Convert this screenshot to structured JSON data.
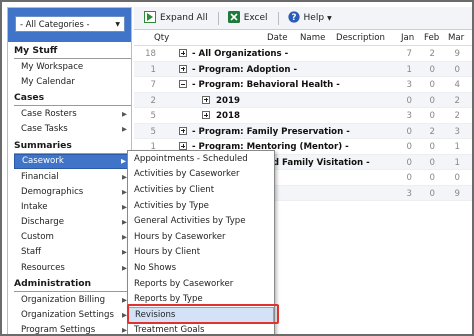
{
  "colors": {
    "accent": "#3f74c9",
    "highlight_border": "#e0322e",
    "menu_highlight": "#d3e2f7"
  },
  "sidebar": {
    "category_select": {
      "value": "- All Categories -",
      "icon": "chevron-down-icon"
    },
    "sections": [
      {
        "title": "My Stuff",
        "items": [
          {
            "label": "My Workspace",
            "submenu": false
          },
          {
            "label": "My Calendar",
            "submenu": false
          }
        ]
      },
      {
        "title": "Cases",
        "items": [
          {
            "label": "Case Rosters",
            "submenu": true
          },
          {
            "label": "Case Tasks",
            "submenu": true
          }
        ]
      },
      {
        "title": "Summaries",
        "items": [
          {
            "label": "Casework",
            "submenu": true,
            "active": true
          },
          {
            "label": "Financial",
            "submenu": true
          },
          {
            "label": "Demographics",
            "submenu": true
          },
          {
            "label": "Intake",
            "submenu": true
          },
          {
            "label": "Discharge",
            "submenu": true
          },
          {
            "label": "Custom",
            "submenu": true
          },
          {
            "label": "Staff",
            "submenu": true
          },
          {
            "label": "Resources",
            "submenu": true
          }
        ]
      },
      {
        "title": "Administration",
        "items": [
          {
            "label": "Organization Billing",
            "submenu": true
          },
          {
            "label": "Organization Settings",
            "submenu": true
          },
          {
            "label": "Program Settings",
            "submenu": true
          }
        ]
      }
    ]
  },
  "toolbar": {
    "expand_all": {
      "label": "Expand All",
      "icon": "expand-all-icon"
    },
    "excel": {
      "label": "Excel",
      "icon": "excel-icon"
    },
    "help": {
      "label": "Help",
      "icon": "help-icon"
    }
  },
  "grid": {
    "columns": {
      "qty": "Qty",
      "date": "Date",
      "name": "Name",
      "description": "Description",
      "jan": "Jan",
      "feb": "Feb",
      "mar": "Mar"
    },
    "rows": [
      {
        "qty": "18",
        "toggle": "plus",
        "label": "- All Organizations -",
        "jan": "7",
        "feb": "2",
        "mar": "9"
      },
      {
        "qty": "1",
        "toggle": "plus",
        "label": "- Program: Adoption -",
        "jan": "1",
        "feb": "0",
        "mar": "0"
      },
      {
        "qty": "7",
        "toggle": "minus",
        "label": "- Program: Behavioral Health -",
        "jan": "3",
        "feb": "0",
        "mar": "4"
      },
      {
        "qty": "2",
        "toggle": "plus",
        "label": "2019",
        "jan": "0",
        "feb": "0",
        "mar": "2"
      },
      {
        "qty": "5",
        "toggle": "plus",
        "label": "2018",
        "jan": "3",
        "feb": "0",
        "mar": "2"
      },
      {
        "qty": "5",
        "toggle": "plus",
        "label": "- Program: Family Preservation -",
        "jan": "0",
        "feb": "2",
        "mar": "3"
      },
      {
        "qty": "1",
        "toggle": "plus",
        "label": "- Program: Mentoring (Mentor) -",
        "jan": "0",
        "feb": "0",
        "mar": "1"
      },
      {
        "qty": "",
        "toggle": "",
        "label": "ised Family Visitation -",
        "jan": "0",
        "feb": "0",
        "mar": "1"
      },
      {
        "qty": "",
        "toggle": "",
        "label": "",
        "jan": "0",
        "feb": "0",
        "mar": "0"
      },
      {
        "qty": "",
        "toggle": "",
        "label": "",
        "jan": "3",
        "feb": "0",
        "mar": "9"
      }
    ]
  },
  "flyout": {
    "items": [
      {
        "label": "Appointments - Scheduled"
      },
      {
        "label": "Activities by Caseworker"
      },
      {
        "label": "Activities by Client"
      },
      {
        "label": "Activities by Type"
      },
      {
        "label": "General Activities by Type"
      },
      {
        "label": "Hours by Caseworker"
      },
      {
        "label": "Hours by Client"
      },
      {
        "label": "No Shows"
      },
      {
        "label": "Reports by Caseworker"
      },
      {
        "label": "Reports by Type"
      },
      {
        "label": "Revisions",
        "highlighted": true
      },
      {
        "label": "Treatment Goals"
      }
    ]
  }
}
